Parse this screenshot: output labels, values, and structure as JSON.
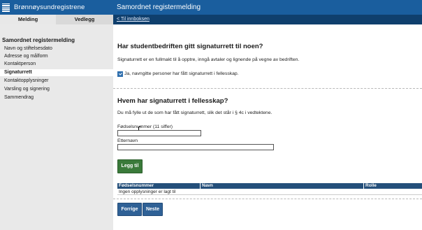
{
  "brand": {
    "name": "Brønnøysundregistrene"
  },
  "app": {
    "title": "Samordnet registermelding"
  },
  "tabs": [
    {
      "label": "Melding"
    },
    {
      "label": "Vedlegg"
    }
  ],
  "back_link": "< Til innboksen",
  "sidebar": {
    "heading": "Samordnet registermelding",
    "items": [
      {
        "label": "Navn og stiftelsesdato",
        "active": false
      },
      {
        "label": "Adresse og målform",
        "active": false
      },
      {
        "label": "Kontaktperson",
        "active": false
      },
      {
        "label": "Signaturrett",
        "active": true
      },
      {
        "label": "Kontaktopplysninger",
        "active": false
      },
      {
        "label": "Varsling og signering",
        "active": false
      },
      {
        "label": "Sammendrag",
        "active": false
      }
    ]
  },
  "section1": {
    "title": "Har studentbedriften gitt signaturrett til noen?",
    "description": "Signaturrett er en fullmakt til å opptre, inngå avtaler og lignende på vegne av bedriften.",
    "checkbox_label": "Ja, navngitte personer har fått signaturrett i fellesskap.",
    "checked": true
  },
  "section2": {
    "title": "Hvem har signaturrett i fellesskap?",
    "description": "Du må fylle ut de som har fått signaturrett, slik det står i § 4c i vedtektene.",
    "fields": {
      "ssn_label": "Fødselsnummer (11 siffer)",
      "ssn_value": "",
      "lastname_label": "Etternavn",
      "lastname_value": ""
    },
    "add_button": "Legg til",
    "table": {
      "columns": [
        "Fødselsnummer",
        "Navn",
        "Rolle"
      ],
      "empty_text": "Ingen opplysninger er lagt til"
    }
  },
  "footer": {
    "prev_button": "Forrige",
    "next_button": "Neste"
  },
  "colors": {
    "header_blue": "#1a5e9e",
    "nav_dark": "#0f3f6d",
    "button_green": "#3a7a3a",
    "button_blue": "#2f6196"
  }
}
